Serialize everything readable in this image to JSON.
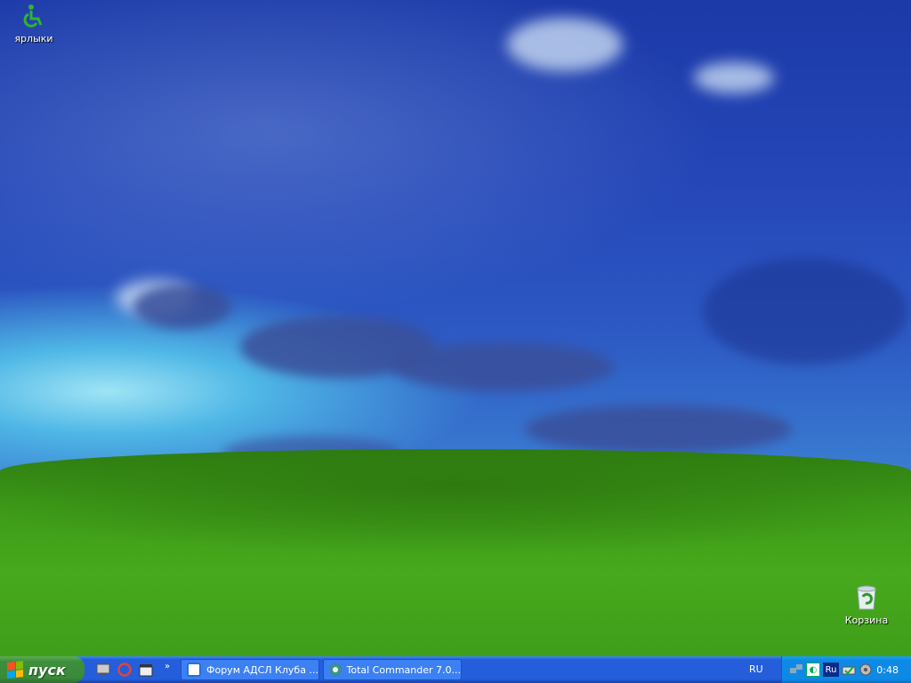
{
  "desktop": {
    "icons": [
      {
        "label": "ярлыки",
        "icon": "accessibility-icon"
      },
      {
        "label": "Корзина",
        "icon": "recycle-bin-icon"
      }
    ]
  },
  "taskbar": {
    "start_label": "пуск",
    "quick_launch": [
      "show-desktop-icon",
      "opera-icon",
      "media-player-classic-icon"
    ],
    "chevron": "»",
    "tasks": [
      {
        "label": "Форум АДСЛ Клуба ...",
        "icon": "ie-icon"
      },
      {
        "label": "Total Commander 7.0...",
        "icon": "total-commander-icon"
      }
    ],
    "language": "RU",
    "tray": {
      "lang_indicator": "Ru",
      "clock": "0:48"
    }
  },
  "colors": {
    "taskbar": "#245edb",
    "start": "#3a8a3a",
    "tray": "#0e8ae6"
  }
}
